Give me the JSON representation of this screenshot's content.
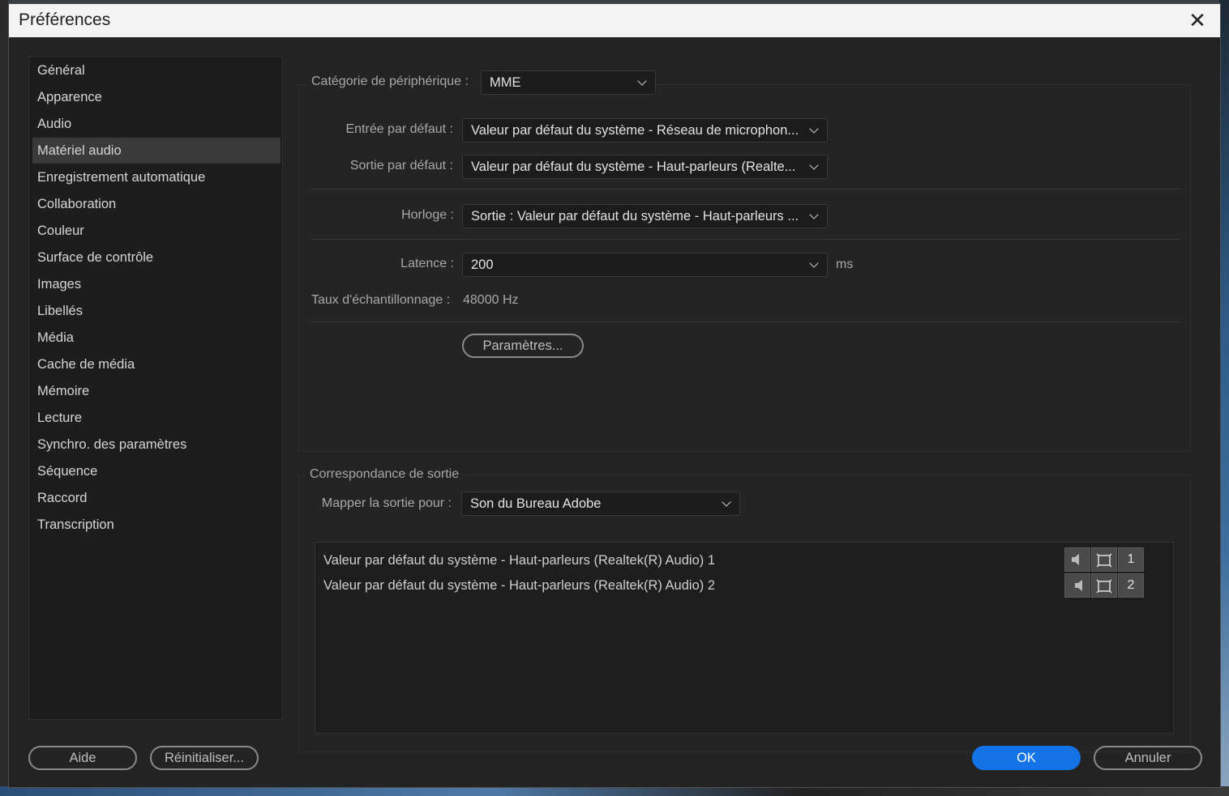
{
  "window": {
    "title": "Préférences",
    "close_glyph": "✕"
  },
  "sidebar": {
    "items": [
      {
        "label": "Général"
      },
      {
        "label": "Apparence"
      },
      {
        "label": "Audio"
      },
      {
        "label": "Matériel audio",
        "selected": true
      },
      {
        "label": "Enregistrement automatique"
      },
      {
        "label": "Collaboration"
      },
      {
        "label": "Couleur"
      },
      {
        "label": "Surface de contrôle"
      },
      {
        "label": "Images"
      },
      {
        "label": "Libellés"
      },
      {
        "label": "Média"
      },
      {
        "label": "Cache de média"
      },
      {
        "label": "Mémoire"
      },
      {
        "label": "Lecture"
      },
      {
        "label": "Synchro. des paramètres"
      },
      {
        "label": "Séquence"
      },
      {
        "label": "Raccord"
      },
      {
        "label": "Transcription"
      }
    ]
  },
  "device": {
    "category_label": "Catégorie de périphérique :",
    "category_value": "MME",
    "input_label": "Entrée par défaut :",
    "input_value": "Valeur par défaut du système - Réseau de microphon...",
    "output_label": "Sortie par défaut :",
    "output_value": "Valeur par défaut du système - Haut-parleurs (Realte...",
    "clock_label": "Horloge :",
    "clock_value": "Sortie : Valeur par défaut du système - Haut-parleurs ...",
    "latency_label": "Latence :",
    "latency_value": "200",
    "latency_unit": "ms",
    "sample_rate_label": "Taux d'échantillonnage :",
    "sample_rate_value": "48000 Hz",
    "settings_button": "Paramètres..."
  },
  "output_mapping": {
    "legend": "Correspondance de sortie",
    "map_for_label": "Mapper la sortie pour :",
    "map_for_value": "Son du Bureau Adobe",
    "rows": [
      {
        "name": "Valeur par défaut du système - Haut-parleurs (Realtek(R) Audio) 1",
        "channel": "1"
      },
      {
        "name": "Valeur par défaut du système - Haut-parleurs (Realtek(R) Audio) 2",
        "channel": "2"
      }
    ]
  },
  "footer": {
    "help": "Aide",
    "reset": "Réinitialiser...",
    "ok": "OK",
    "cancel": "Annuler"
  },
  "colors": {
    "accent": "#1473e6",
    "dialog_bg": "#232323"
  }
}
